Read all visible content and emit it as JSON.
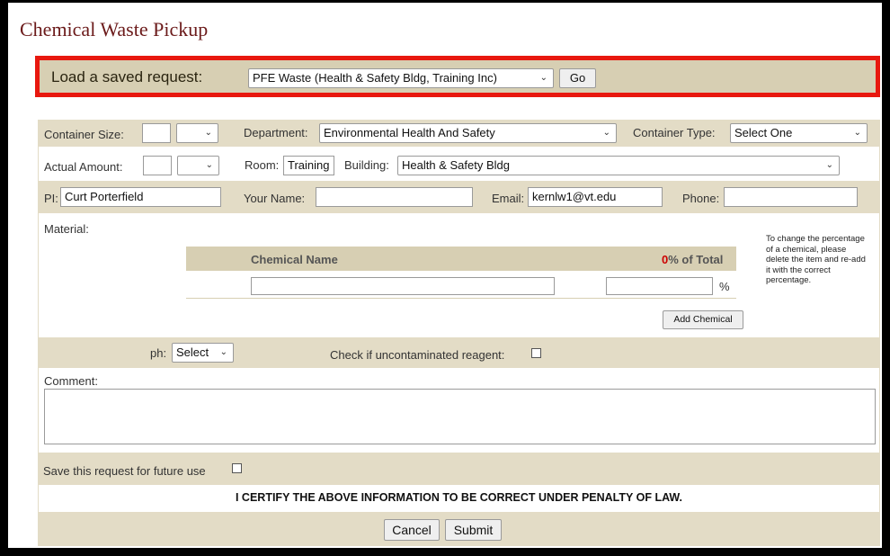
{
  "page": {
    "title": "Chemical Waste Pickup"
  },
  "saved_request": {
    "label": "Load a saved request:",
    "selected": "PFE Waste (Health & Safety Bldg, Training Inc)",
    "go_label": "Go"
  },
  "container": {
    "size_label": "Container Size:",
    "size_value": "",
    "size_unit": "",
    "department_label": "Department:",
    "department_value": "Environmental Health And Safety",
    "type_label": "Container Type:",
    "type_value": "Select One"
  },
  "amount": {
    "label": "Actual Amount:",
    "value": "",
    "unit": "",
    "room_label": "Room:",
    "room_value": "Training Inc",
    "building_label": "Building:",
    "building_value": "Health & Safety Bldg"
  },
  "contact": {
    "pi_label": "PI:",
    "pi_value": "Curt Porterfield",
    "name_label": "Your Name:",
    "name_value": "",
    "email_label": "Email:",
    "email_value": "kernlw1@vt.edu",
    "phone_label": "Phone:",
    "phone_value": ""
  },
  "material": {
    "label": "Material:",
    "col_name": "Chemical Name",
    "percent_total": "0",
    "percent_suffix": "% of Total",
    "percent_sign": "%",
    "add_label": "Add Chemical",
    "note": "To change the percentage of a chemical, please delete the item and re-add it with the correct percentage."
  },
  "ph": {
    "label": "ph:",
    "value": "Select",
    "reagent_label": "Check if uncontaminated reagent:"
  },
  "comment": {
    "label": "Comment:"
  },
  "save": {
    "label": "Save this request for future use"
  },
  "certify": {
    "text": "I CERTIFY THE ABOVE INFORMATION TO BE CORRECT UNDER PENALTY OF LAW."
  },
  "actions": {
    "cancel_label": "Cancel",
    "submit_label": "Submit"
  },
  "colors": {
    "title": "#6b1a1a",
    "highlight_border": "#e8180f",
    "tan": "#e3dcc6",
    "percent_red": "#cc0000"
  },
  "icons": {
    "dropdown": "chevron-down-icon"
  }
}
